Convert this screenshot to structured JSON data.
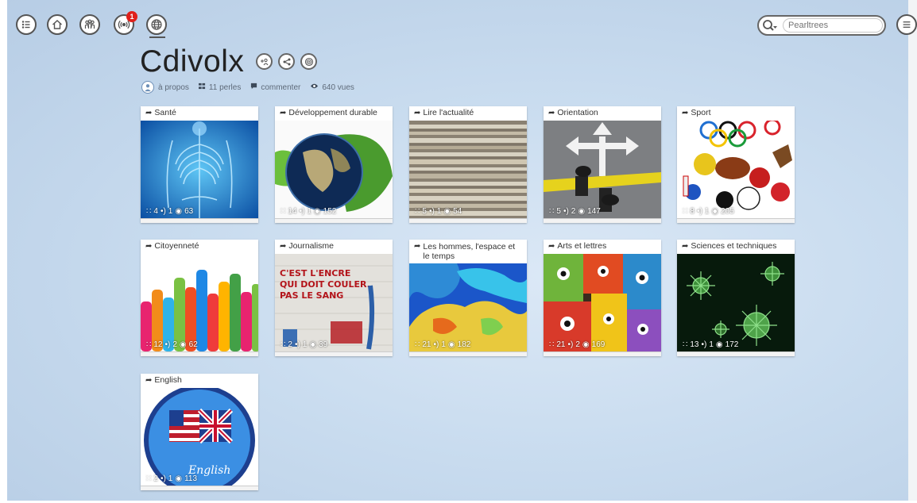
{
  "nav": {
    "notification_count": "1",
    "search_placeholder": "Pearltrees"
  },
  "collection": {
    "title": "Cdivolx",
    "about_label": "à propos",
    "pearls_label": "11 perles",
    "comment_label": "commenter",
    "views_label": "640 vues"
  },
  "cards": [
    {
      "label": "Santé",
      "pearls": "4",
      "notes": "1",
      "views": "63",
      "image": "skeleton"
    },
    {
      "label": "Développement durable",
      "pearls": "14",
      "notes": "1",
      "views": "152",
      "image": "globe-leaf"
    },
    {
      "label": "Lire l'actualité",
      "pearls": "5",
      "notes": "1",
      "views": "54",
      "image": "newspapers"
    },
    {
      "label": "Orientation",
      "pearls": "5",
      "notes": "2",
      "views": "147",
      "image": "arrows-road"
    },
    {
      "label": "Sport",
      "pearls": "8",
      "notes": "1",
      "views": "205",
      "image": "sport-balls"
    },
    {
      "label": "Citoyenneté",
      "pearls": "12",
      "notes": "2",
      "views": "62",
      "image": "raised-hands"
    },
    {
      "label": "Journalisme",
      "pearls": "2",
      "notes": "1",
      "views": "39",
      "image": "graffiti-wall"
    },
    {
      "label": "Les hommes, l'espace et le temps",
      "pearls": "21",
      "notes": "1",
      "views": "182",
      "image": "map"
    },
    {
      "label": "Arts et lettres",
      "pearls": "21",
      "notes": "2",
      "views": "169",
      "image": "street-art"
    },
    {
      "label": "Sciences et techniques",
      "pearls": "13",
      "notes": "1",
      "views": "172",
      "image": "virus"
    },
    {
      "label": "English",
      "pearls": "2",
      "notes": "1",
      "views": "113",
      "image": "uk-us-flag-badge"
    }
  ],
  "card_tall_text": {
    "wall_line1": "C'EST L'ENCRE",
    "wall_line2": "QUI DOIT COULER.",
    "wall_line3": "PAS LE SANG",
    "badge_word": "English"
  }
}
